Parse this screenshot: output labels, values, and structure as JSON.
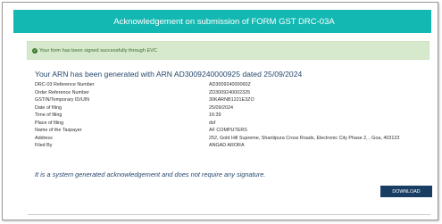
{
  "header": {
    "title": "Acknowledgement on submission of FORM GST DRC-03A"
  },
  "alert": {
    "icon": "check-circle-icon",
    "message": "Your form has been signed successfully through EVC"
  },
  "arn_heading": "Your ARN has been generated with ARN AD3009240000925 dated 25/09/2024",
  "details": [
    {
      "label": "DRC-03 Reference Number",
      "value": "AD300924000060Z"
    },
    {
      "label": "Order Reference Number",
      "value": "ZD3009240002325"
    },
    {
      "label": "GSTIN/Temporary ID/UIN",
      "value": "30KARNB1221E3ZO"
    },
    {
      "label": "Date of filing",
      "value": "25/09/2024"
    },
    {
      "label": "Time of filing",
      "value": "16:39"
    },
    {
      "label": "Place of filing",
      "value": "dsf"
    },
    {
      "label": "Name of the Taxpayer",
      "value": "AF COMPUTERS"
    },
    {
      "label": "Address",
      "value": "252, Gold Hill Supreme, Shantipura Cross Roads, Electronic City Phase 2, , Goa, 403123"
    },
    {
      "label": "Filed By",
      "value": "ANGAD ARORA"
    }
  ],
  "note": "It is a system generated acknowledgement and does not require any signature.",
  "actions": {
    "download_label": "DOWNLOAD"
  },
  "colors": {
    "header_bg": "#14b8b2",
    "success_bg": "#d6e9cc",
    "button_bg": "#1a3e63",
    "heading_text": "#27496d"
  }
}
